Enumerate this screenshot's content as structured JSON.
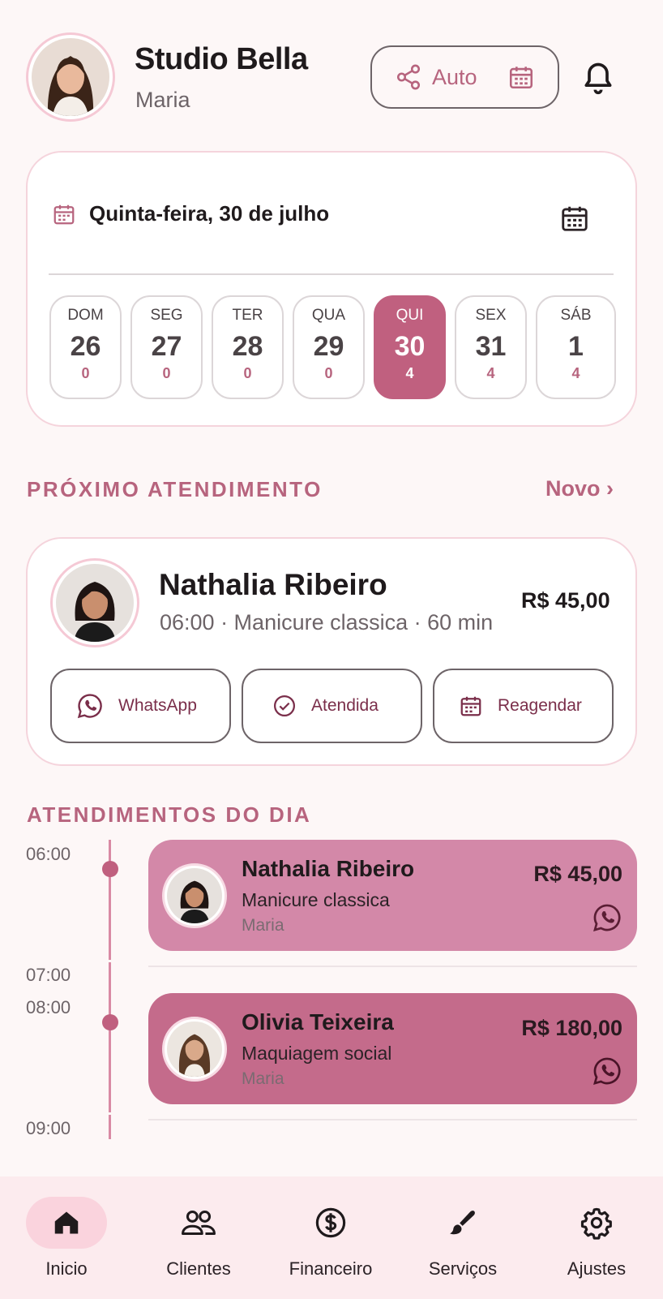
{
  "header": {
    "title": "Studio Bella",
    "subtitle": "Maria",
    "auto_label": "Auto"
  },
  "date_card": {
    "date_label": "Quinta-feira, 30 de julho",
    "days": [
      {
        "name": "DOM",
        "day": "26",
        "count": "0",
        "active": false
      },
      {
        "name": "SEG",
        "day": "27",
        "count": "0",
        "active": false
      },
      {
        "name": "TER",
        "day": "28",
        "count": "0",
        "active": false
      },
      {
        "name": "QUA",
        "day": "29",
        "count": "0",
        "active": false
      },
      {
        "name": "QUI",
        "day": "30",
        "count": "4",
        "active": true
      },
      {
        "name": "SEX",
        "day": "31",
        "count": "4",
        "active": false
      },
      {
        "name": "SÁB",
        "day": "1",
        "count": "4",
        "active": false
      }
    ]
  },
  "next": {
    "heading": "PRÓXIMO ATENDIMENTO",
    "new_label": "Novo ›",
    "name": "Nathalia Ribeiro",
    "meta": "06:00  ·  Manicure classica  ·  60 min",
    "price": "R$ 45,00",
    "actions": {
      "whatsapp": "WhatsApp",
      "attended": "Atendida",
      "reschedule": "Reagendar"
    }
  },
  "day_list": {
    "heading": "ATENDIMENTOS DO DIA",
    "times": [
      "06:00",
      "07:00",
      "08:00",
      "09:00"
    ],
    "appointments": [
      {
        "name": "Nathalia Ribeiro",
        "service": "Manicure classica",
        "professional": "Maria",
        "price": "R$ 45,00"
      },
      {
        "name": "Olivia Teixeira",
        "service": "Maquiagem social",
        "professional": "Maria",
        "price": "R$ 180,00"
      }
    ]
  },
  "nav": {
    "items": [
      "Inicio",
      "Clientes",
      "Financeiro",
      "Serviços",
      "Ajustes"
    ],
    "active": "Inicio"
  },
  "colors": {
    "accent": "#c0607f",
    "accent_text": "#b7647e",
    "card_light": "#d388a8",
    "card_dark": "#c46b8b",
    "background": "#fdf7f7"
  }
}
